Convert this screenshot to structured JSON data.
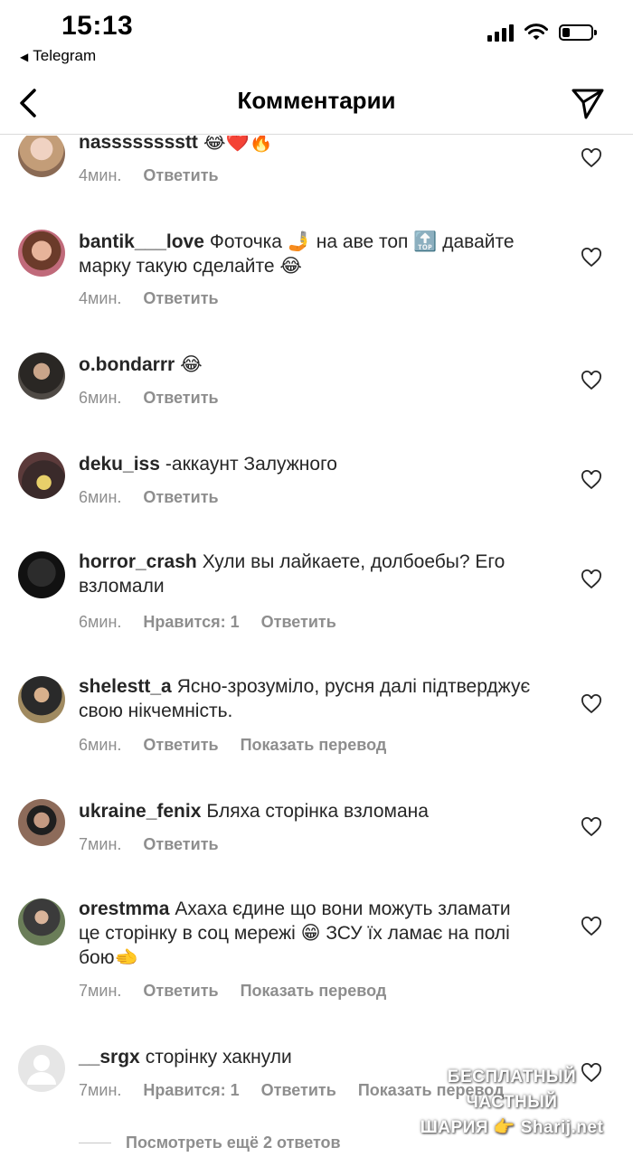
{
  "status_bar": {
    "time": "15:13",
    "back_app": "Telegram"
  },
  "header": {
    "title": "Комментарии"
  },
  "comments": [
    {
      "username": "nasssssssstt",
      "text": "😂❤️🔥",
      "time": "4мин.",
      "reply": "Ответить",
      "likes": "",
      "translate": ""
    },
    {
      "username": "bantik___love",
      "text": "Фоточка 🤳 на аве топ 🔝 давайте марку такую сделайте 😂",
      "time": "4мин.",
      "reply": "Ответить",
      "likes": "",
      "translate": ""
    },
    {
      "username": "o.bondarrr",
      "text": "😂",
      "time": "6мин.",
      "reply": "Ответить",
      "likes": "",
      "translate": ""
    },
    {
      "username": "deku_iss",
      "text": "-аккаунт Залужного",
      "time": "6мин.",
      "reply": "Ответить",
      "likes": "",
      "translate": ""
    },
    {
      "username": "horror_crash",
      "text": "Хули вы лайкаете, долбоебы? Его взломали",
      "time": "6мин.",
      "reply": "Ответить",
      "likes": "Нравится: 1",
      "translate": ""
    },
    {
      "username": "shelestt_a",
      "text": "Ясно-зрозуміло, русня далі підтверджує свою нікчемність.",
      "time": "6мин.",
      "reply": "Ответить",
      "likes": "",
      "translate": "Показать перевод"
    },
    {
      "username": "ukraine_fenix",
      "text": "Бляха сторінка взломана",
      "time": "7мин.",
      "reply": "Ответить",
      "likes": "",
      "translate": ""
    },
    {
      "username": "orestmma",
      "text": "Ахаха єдине що вони можуть зламати це сторінку в соц мережі 😁 ЗСУ їх ламає на полі бою🫲",
      "time": "7мин.",
      "reply": "Ответить",
      "likes": "",
      "translate": "Показать перевод"
    },
    {
      "username": "__srgx",
      "text": "сторінку хакнули",
      "time": "7мин.",
      "reply": "Ответить",
      "likes": "Нравится: 1",
      "translate": "Показать перевод"
    }
  ],
  "more_replies": "Посмотреть ещё 2 ответов",
  "watermark": {
    "line1": "БЕСПЛАТНЫЙ ЧАСТНЫЙ",
    "line2": "ШАРИЯ 👉 Sharij.net"
  }
}
